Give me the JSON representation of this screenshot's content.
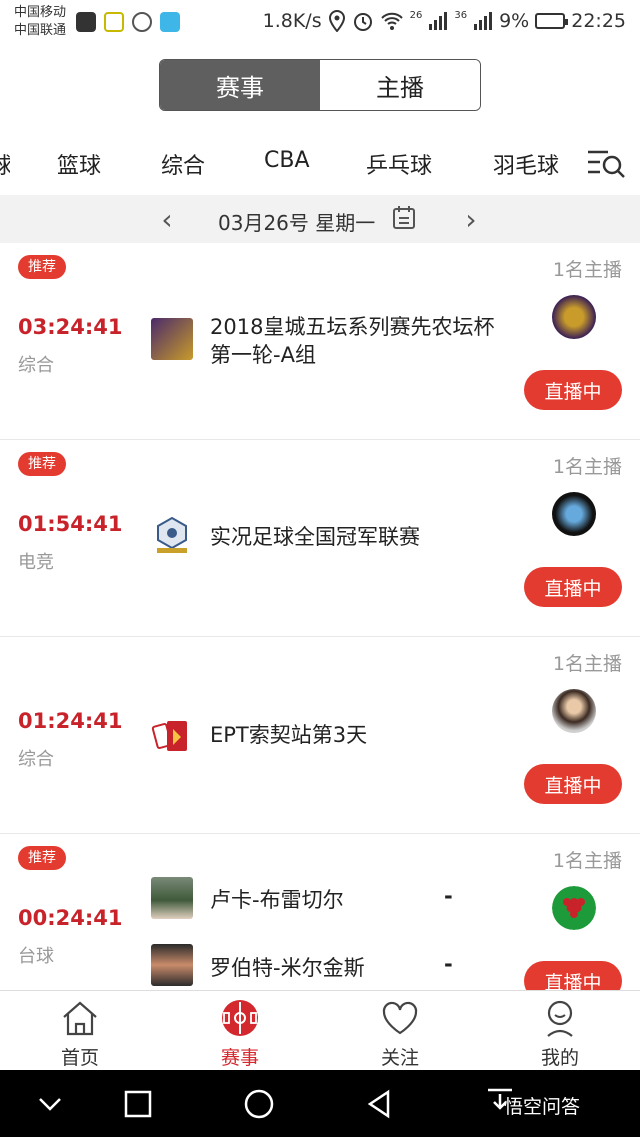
{
  "status_bar": {
    "carrier_1": "中国移动",
    "carrier_2": "中国联通",
    "speed": "1.8K/s",
    "net_1": "26",
    "net_2": "36",
    "battery": "9%",
    "time": "22:25"
  },
  "segmented": {
    "left": "赛事",
    "right": "主播"
  },
  "categories": [
    "篮球",
    "综合",
    "CBA",
    "乒乓球",
    "羽毛球"
  ],
  "date_bar": {
    "date": "03月26号 星期一"
  },
  "matches": [
    {
      "tag": "推荐",
      "time": "03:24:41",
      "category": "综合",
      "title": "2018皇城五坛系列赛先农坛杯第一轮-A组",
      "hosts": "1名主播",
      "live": "直播中"
    },
    {
      "tag": "推荐",
      "time": "01:54:41",
      "category": "电竞",
      "title": "实况足球全国冠军联赛",
      "hosts": "1名主播",
      "live": "直播中"
    },
    {
      "tag": "",
      "time": "01:24:41",
      "category": "综合",
      "title": "EPT索契站第3天",
      "hosts": "1名主播",
      "live": "直播中"
    },
    {
      "tag": "推荐",
      "time": "00:24:41",
      "category": "台球",
      "player_1": "卢卡-布雷切尔",
      "player_2": "罗伯特-米尔金斯",
      "score_1": "-",
      "score_2": "-",
      "hosts": "1名主播",
      "live": "直播中"
    }
  ],
  "bottom_nav": [
    "首页",
    "赛事",
    "关注",
    "我的"
  ],
  "watermark": "悟空问答",
  "colors": {
    "accent": "#e33b2f",
    "time_red": "#c8232a",
    "segment_active": "#5f5f5f"
  }
}
